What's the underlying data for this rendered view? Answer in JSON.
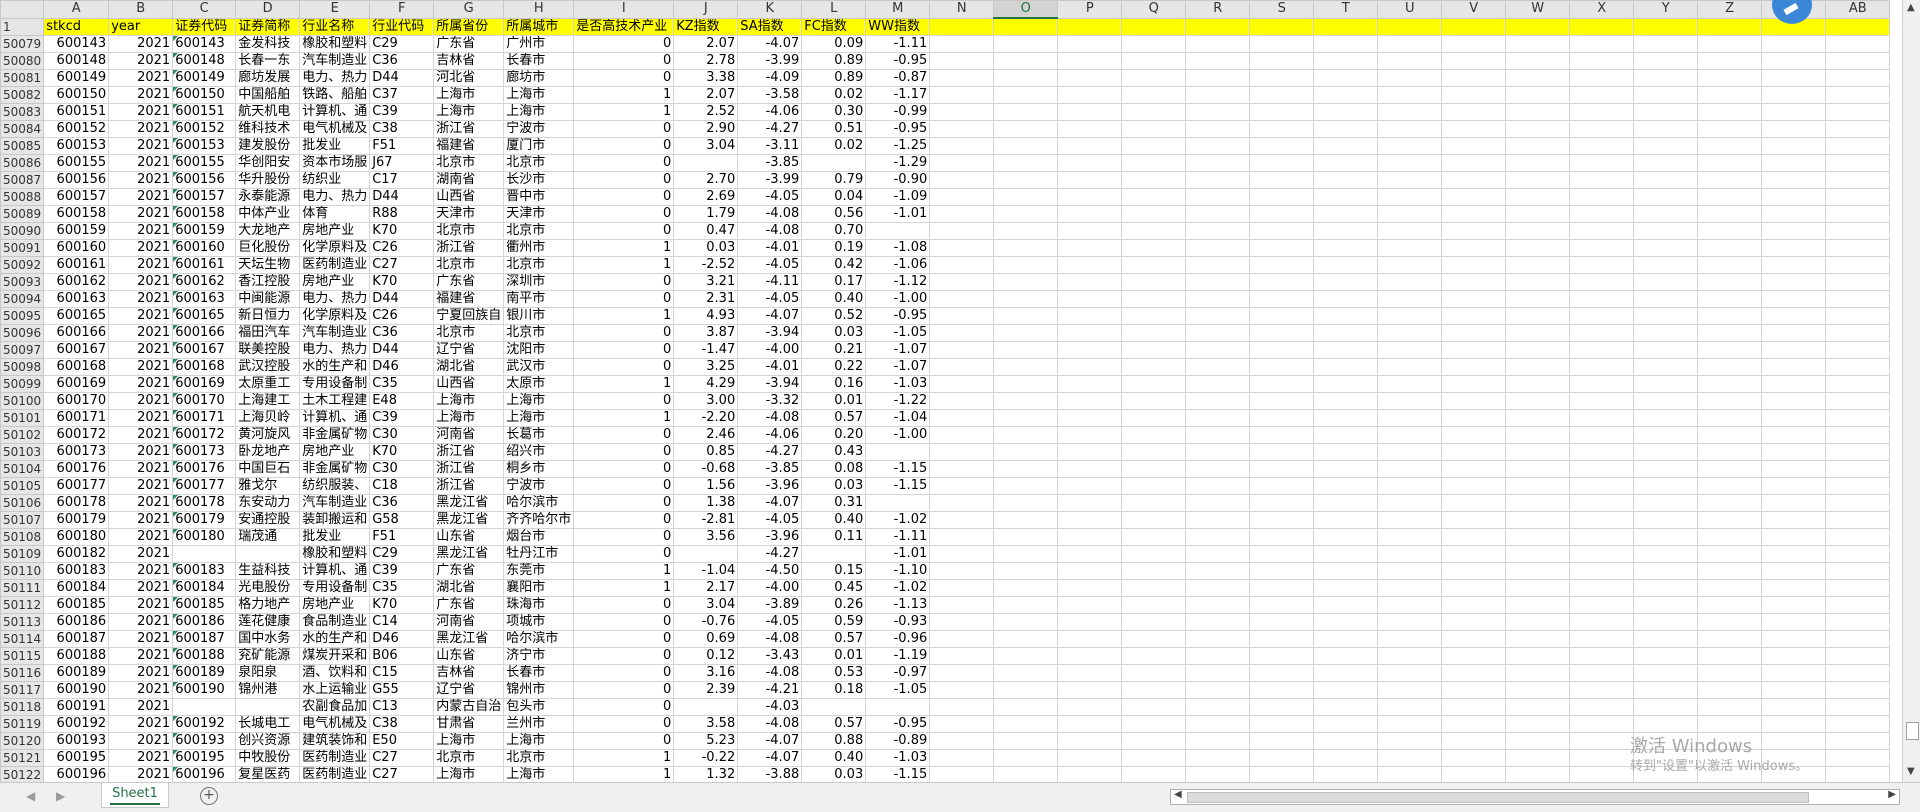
{
  "columns": [
    "A",
    "B",
    "C",
    "D",
    "E",
    "F",
    "G",
    "H",
    "I",
    "J",
    "K",
    "L",
    "M",
    "N",
    "O",
    "P",
    "Q",
    "R",
    "S",
    "T",
    "U",
    "V",
    "W",
    "X",
    "Y",
    "Z",
    "AA",
    "AB"
  ],
  "selected_column": "O",
  "header_row": {
    "row_number": "1",
    "cells": [
      "stkcd",
      "year",
      "证券代码",
      "证券简称",
      "行业名称",
      "行业代码",
      "所属省份",
      "所属城市",
      "是否高技术产业",
      "KZ指数",
      "SA指数",
      "FC指数",
      "WW指数"
    ]
  },
  "rows": [
    [
      "50079",
      "600143",
      "2021",
      "600143",
      "金发科技",
      "橡胶和塑料",
      "C29",
      "广东省",
      "广州市",
      "0",
      "2.07",
      "-4.07",
      "0.09",
      "-1.11"
    ],
    [
      "50080",
      "600148",
      "2021",
      "600148",
      "长春一东",
      "汽车制造业",
      "C36",
      "吉林省",
      "长春市",
      "0",
      "2.78",
      "-3.99",
      "0.89",
      "-0.95"
    ],
    [
      "50081",
      "600149",
      "2021",
      "600149",
      "廊坊发展",
      "电力、热力",
      "D44",
      "河北省",
      "廊坊市",
      "0",
      "3.38",
      "-4.09",
      "0.89",
      "-0.87"
    ],
    [
      "50082",
      "600150",
      "2021",
      "600150",
      "中国船舶",
      "铁路、船舶",
      "C37",
      "上海市",
      "上海市",
      "1",
      "2.07",
      "-3.58",
      "0.02",
      "-1.17"
    ],
    [
      "50083",
      "600151",
      "2021",
      "600151",
      "航天机电",
      "计算机、通",
      "C39",
      "上海市",
      "上海市",
      "1",
      "2.52",
      "-4.06",
      "0.30",
      "-0.99"
    ],
    [
      "50084",
      "600152",
      "2021",
      "600152",
      "维科技术",
      "电气机械及",
      "C38",
      "浙江省",
      "宁波市",
      "0",
      "2.90",
      "-4.27",
      "0.51",
      "-0.95"
    ],
    [
      "50085",
      "600153",
      "2021",
      "600153",
      "建发股份",
      "批发业",
      "F51",
      "福建省",
      "厦门市",
      "0",
      "3.04",
      "-3.11",
      "0.02",
      "-1.25"
    ],
    [
      "50086",
      "600155",
      "2021",
      "600155",
      "华创阳安",
      "资本市场服",
      "J67",
      "北京市",
      "北京市",
      "0",
      "",
      "-3.85",
      "",
      "-1.29"
    ],
    [
      "50087",
      "600156",
      "2021",
      "600156",
      "华升股份",
      "纺织业",
      "C17",
      "湖南省",
      "长沙市",
      "0",
      "2.70",
      "-3.99",
      "0.79",
      "-0.90"
    ],
    [
      "50088",
      "600157",
      "2021",
      "600157",
      "永泰能源",
      "电力、热力",
      "D44",
      "山西省",
      "晋中市",
      "0",
      "2.69",
      "-4.05",
      "0.04",
      "-1.09"
    ],
    [
      "50089",
      "600158",
      "2021",
      "600158",
      "中体产业",
      "体育",
      "R88",
      "天津市",
      "天津市",
      "0",
      "1.79",
      "-4.08",
      "0.56",
      "-1.01"
    ],
    [
      "50090",
      "600159",
      "2021",
      "600159",
      "大龙地产",
      "房地产业",
      "K70",
      "北京市",
      "北京市",
      "0",
      "0.47",
      "-4.08",
      "0.70",
      ""
    ],
    [
      "50091",
      "600160",
      "2021",
      "600160",
      "巨化股份",
      "化学原料及",
      "C26",
      "浙江省",
      "衢州市",
      "1",
      "0.03",
      "-4.01",
      "0.19",
      "-1.08"
    ],
    [
      "50092",
      "600161",
      "2021",
      "600161",
      "天坛生物",
      "医药制造业",
      "C27",
      "北京市",
      "北京市",
      "1",
      "-2.52",
      "-4.05",
      "0.42",
      "-1.06"
    ],
    [
      "50093",
      "600162",
      "2021",
      "600162",
      "香江控股",
      "房地产业",
      "K70",
      "广东省",
      "深圳市",
      "0",
      "3.21",
      "-4.11",
      "0.17",
      "-1.12"
    ],
    [
      "50094",
      "600163",
      "2021",
      "600163",
      "中闽能源",
      "电力、热力",
      "D44",
      "福建省",
      "南平市",
      "0",
      "2.31",
      "-4.05",
      "0.40",
      "-1.00"
    ],
    [
      "50095",
      "600165",
      "2021",
      "600165",
      "新日恒力",
      "化学原料及",
      "C26",
      "宁夏回族自",
      "银川市",
      "1",
      "4.93",
      "-4.07",
      "0.52",
      "-0.95"
    ],
    [
      "50096",
      "600166",
      "2021",
      "600166",
      "福田汽车",
      "汽车制造业",
      "C36",
      "北京市",
      "北京市",
      "0",
      "3.87",
      "-3.94",
      "0.03",
      "-1.05"
    ],
    [
      "50097",
      "600167",
      "2021",
      "600167",
      "联美控股",
      "电力、热力",
      "D44",
      "辽宁省",
      "沈阳市",
      "0",
      "-1.47",
      "-4.00",
      "0.21",
      "-1.07"
    ],
    [
      "50098",
      "600168",
      "2021",
      "600168",
      "武汉控股",
      "水的生产和",
      "D46",
      "湖北省",
      "武汉市",
      "0",
      "3.25",
      "-4.01",
      "0.22",
      "-1.07"
    ],
    [
      "50099",
      "600169",
      "2021",
      "600169",
      "太原重工",
      "专用设备制",
      "C35",
      "山西省",
      "太原市",
      "1",
      "4.29",
      "-3.94",
      "0.16",
      "-1.03"
    ],
    [
      "50100",
      "600170",
      "2021",
      "600170",
      "上海建工",
      "土木工程建",
      "E48",
      "上海市",
      "上海市",
      "0",
      "3.00",
      "-3.32",
      "0.01",
      "-1.22"
    ],
    [
      "50101",
      "600171",
      "2021",
      "600171",
      "上海贝岭",
      "计算机、通",
      "C39",
      "上海市",
      "上海市",
      "1",
      "-2.20",
      "-4.08",
      "0.57",
      "-1.04"
    ],
    [
      "50102",
      "600172",
      "2021",
      "600172",
      "黄河旋风",
      "非金属矿物",
      "C30",
      "河南省",
      "长葛市",
      "0",
      "2.46",
      "-4.06",
      "0.20",
      "-1.00"
    ],
    [
      "50103",
      "600173",
      "2021",
      "600173",
      "卧龙地产",
      "房地产业",
      "K70",
      "浙江省",
      "绍兴市",
      "0",
      "0.85",
      "-4.27",
      "0.43",
      ""
    ],
    [
      "50104",
      "600176",
      "2021",
      "600176",
      "中国巨石",
      "非金属矿物",
      "C30",
      "浙江省",
      "桐乡市",
      "0",
      "-0.68",
      "-3.85",
      "0.08",
      "-1.15"
    ],
    [
      "50105",
      "600177",
      "2021",
      "600177",
      "雅戈尔",
      "纺织服装、",
      "C18",
      "浙江省",
      "宁波市",
      "0",
      "1.56",
      "-3.96",
      "0.03",
      "-1.15"
    ],
    [
      "50106",
      "600178",
      "2021",
      "600178",
      "东安动力",
      "汽车制造业",
      "C36",
      "黑龙江省",
      "哈尔滨市",
      "0",
      "1.38",
      "-4.07",
      "0.31",
      ""
    ],
    [
      "50107",
      "600179",
      "2021",
      "600179",
      "安通控股",
      "装卸搬运和",
      "G58",
      "黑龙江省",
      "齐齐哈尔市",
      "0",
      "-2.81",
      "-4.05",
      "0.40",
      "-1.02"
    ],
    [
      "50108",
      "600180",
      "2021",
      "600180",
      "瑞茂通",
      "批发业",
      "F51",
      "山东省",
      "烟台市",
      "0",
      "3.56",
      "-3.96",
      "0.11",
      "-1.11"
    ],
    [
      "50109",
      "600182",
      "2021",
      "",
      "",
      "橡胶和塑料",
      "C29",
      "黑龙江省",
      "牡丹江市",
      "0",
      "",
      "-4.27",
      "",
      "-1.01"
    ],
    [
      "50110",
      "600183",
      "2021",
      "600183",
      "生益科技",
      "计算机、通",
      "C39",
      "广东省",
      "东莞市",
      "1",
      "-1.04",
      "-4.50",
      "0.15",
      "-1.10"
    ],
    [
      "50111",
      "600184",
      "2021",
      "600184",
      "光电股份",
      "专用设备制",
      "C35",
      "湖北省",
      "襄阳市",
      "1",
      "2.17",
      "-4.00",
      "0.45",
      "-1.02"
    ],
    [
      "50112",
      "600185",
      "2021",
      "600185",
      "格力地产",
      "房地产业",
      "K70",
      "广东省",
      "珠海市",
      "0",
      "3.04",
      "-3.89",
      "0.26",
      "-1.13"
    ],
    [
      "50113",
      "600186",
      "2021",
      "600186",
      "莲花健康",
      "食品制造业",
      "C14",
      "河南省",
      "项城市",
      "0",
      "-0.76",
      "-4.05",
      "0.59",
      "-0.93"
    ],
    [
      "50114",
      "600187",
      "2021",
      "600187",
      "国中水务",
      "水的生产和",
      "D46",
      "黑龙江省",
      "哈尔滨市",
      "0",
      "0.69",
      "-4.08",
      "0.57",
      "-0.96"
    ],
    [
      "50115",
      "600188",
      "2021",
      "600188",
      "兖矿能源",
      "煤炭开采和",
      "B06",
      "山东省",
      "济宁市",
      "0",
      "0.12",
      "-3.43",
      "0.01",
      "-1.19"
    ],
    [
      "50116",
      "600189",
      "2021",
      "600189",
      "泉阳泉",
      "酒、饮料和",
      "C15",
      "吉林省",
      "长春市",
      "0",
      "3.16",
      "-4.08",
      "0.53",
      "-0.97"
    ],
    [
      "50117",
      "600190",
      "2021",
      "600190",
      "锦州港",
      "水上运输业",
      "G55",
      "辽宁省",
      "锦州市",
      "0",
      "2.39",
      "-4.21",
      "0.18",
      "-1.05"
    ],
    [
      "50118",
      "600191",
      "2021",
      "",
      "",
      "农副食品加",
      "C13",
      "内蒙古自治",
      "包头市",
      "0",
      "",
      "-4.03",
      "",
      ""
    ],
    [
      "50119",
      "600192",
      "2021",
      "600192",
      "长城电工",
      "电气机械及",
      "C38",
      "甘肃省",
      "兰州市",
      "0",
      "3.58",
      "-4.08",
      "0.57",
      "-0.95"
    ],
    [
      "50120",
      "600193",
      "2021",
      "600193",
      "创兴资源",
      "建筑装饰和",
      "E50",
      "上海市",
      "上海市",
      "0",
      "5.23",
      "-4.07",
      "0.88",
      "-0.89"
    ],
    [
      "50121",
      "600195",
      "2021",
      "600195",
      "中牧股份",
      "医药制造业",
      "C27",
      "北京市",
      "北京市",
      "1",
      "-0.22",
      "-4.07",
      "0.40",
      "-1.03"
    ],
    [
      "50122",
      "600196",
      "2021",
      "600196",
      "复星医药",
      "医药制造业",
      "C27",
      "上海市",
      "上海市",
      "1",
      "1.32",
      "-3.88",
      "0.03",
      "-1.15"
    ]
  ],
  "sheet_tabs": [
    "Sheet1"
  ],
  "watermark": {
    "line1": "激活 Windows",
    "line2": "转到\"设置\"以激活 Windows。"
  },
  "icons": {
    "add_sheet": "plus-circle-icon",
    "nav_prev": "triangle-left-icon",
    "nav_next": "triangle-right-icon"
  },
  "colors": {
    "header_fill": "#ffff00",
    "tab_accent": "#217346",
    "text_marker": "#2e8b57"
  }
}
